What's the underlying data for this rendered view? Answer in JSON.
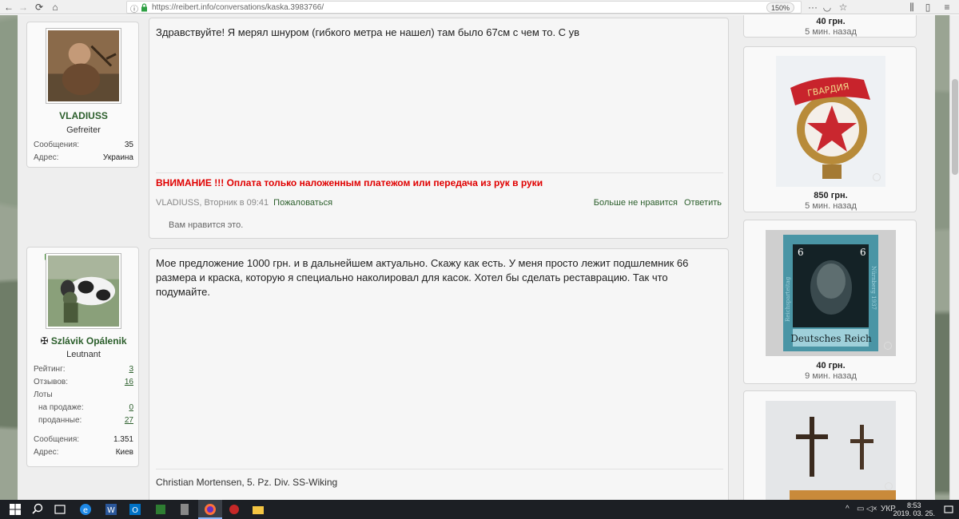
{
  "browser": {
    "url": "https://reibert.info/conversations/kaska.3983766/",
    "zoom": "150%"
  },
  "messages": [
    {
      "user": {
        "name": "VLADIUSS",
        "role": "Gefreiter",
        "stats": [
          {
            "label": "Сообщения:",
            "value": "35"
          },
          {
            "label": "Адрес:",
            "value": "Украина"
          }
        ]
      },
      "text": "Здравствуйте! Я мерял шнуром (гибкого метра не нашел) там было 67см с чем то. С ув",
      "warning": "ВНИМАНИЕ !!! Оплата только наложенным платежом или передача из рук в руки",
      "meta": "VLADIUSS, Вторник в 09:41",
      "report": "Пожаловаться",
      "unlike": "Больше не нравится",
      "reply": "Ответить",
      "likes": "Вам нравится это."
    },
    {
      "user": {
        "name": "Szlávik Opálenik",
        "role": "Leutnant",
        "cross": "✠",
        "stats": [
          {
            "label": "Рейтинг:",
            "value": "3"
          },
          {
            "label": "Отзывов:",
            "value": "16"
          },
          {
            "label": "Лоты",
            "value": ""
          },
          {
            "label": "на продаже:",
            "value": "0"
          },
          {
            "label": "проданные:",
            "value": "27"
          },
          {
            "label": "Сообщения:",
            "value": "1.351"
          },
          {
            "label": "Адрес:",
            "value": "Киев"
          }
        ]
      },
      "text": "Мое предложение 1000 грн. и в дальнейшем актуально. Скажу как есть. У меня просто лежит подшлемник 66 размера и краска, которую я специально наколировал для касок. Хотел бы сделать реставрацию. Так что подумайте.",
      "signature": "Christian Mortensen, 5. Pz. Div. SS-Wiking"
    }
  ],
  "sidebar": [
    {
      "price": "40 грн.",
      "time": "5 мин. назад"
    },
    {
      "price": "850 грн.",
      "time": "5 мин. назад",
      "image": "guards-badge"
    },
    {
      "price": "40 грн.",
      "time": "9 мин. назад",
      "image": "stamp"
    },
    {
      "image": "crosses"
    }
  ],
  "stamp": {
    "value": "6",
    "left_text": "Reichsparteitag",
    "right_text": "Nürnberg 1937",
    "bottom_text": "Deutsches Reich"
  },
  "badge": {
    "text": "ГВАРДИЯ"
  },
  "taskbar": {
    "lang": "УКР",
    "time": "8:53",
    "date": "2019. 03. 25."
  },
  "colors": {
    "accent": "#2b5e2b",
    "warning": "#e00000"
  }
}
